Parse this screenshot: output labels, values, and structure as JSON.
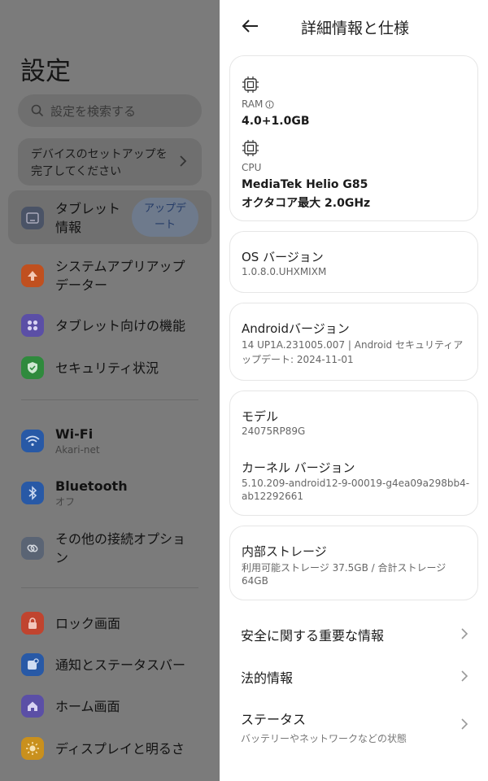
{
  "left": {
    "title": "設定",
    "search_placeholder": "設定を検索する",
    "setup_line1": "デバイスのセットアップを",
    "setup_line2": "完了してください",
    "items": [
      {
        "label1": "タブレット",
        "label2": "情報",
        "color": "#4a5366"
      },
      {
        "label1": "システムアプリアップ",
        "label2": "データー",
        "color": "#c0501f"
      },
      {
        "label1": "タブレット向けの機能",
        "color": "#5b4fa6"
      },
      {
        "label1": "セキュリティ状況",
        "color": "#2f8a3d"
      },
      {
        "label1": "Wi-Fi",
        "sub": "Akari-net",
        "color": "#2859a6"
      },
      {
        "label1": "Bluetooth",
        "sub": "オフ",
        "color": "#2859a6"
      },
      {
        "label1": "その他の接続オプショ",
        "label2": "ン",
        "color": "#5a6474"
      },
      {
        "label1": "ロック画面",
        "color": "#c0442f"
      },
      {
        "label1": "通知とステータスバー",
        "color": "#2859a6"
      },
      {
        "label1": "ホーム画面",
        "color": "#5b4fa6"
      },
      {
        "label1": "ディスプレイと明るさ",
        "color": "#c9901d"
      }
    ],
    "update_line1": "アップデ",
    "update_line2": "ート"
  },
  "right": {
    "title": "詳細情報と仕様",
    "ram_label": "RAM",
    "ram_value": "4.0+1.0GB",
    "cpu_label": "CPU",
    "cpu_value1": "MediaTek Helio G85",
    "cpu_value2": "オクタコア最大 2.0GHz",
    "os_label": "OS バージョン",
    "os_value": "1.0.8.0.UHXMIXM",
    "android_label": "Androidバージョン",
    "android_value1": "14 UP1A.231005.007 | Android セキュリティア",
    "android_value2": "ップデート: 2024-11-01",
    "model_label": "モデル",
    "model_value": "24075RP89G",
    "kernel_label": "カーネル バージョン",
    "kernel_value1": "5.10.209-android12-9-00019-g4ea09a298bb4-",
    "kernel_value2": "ab12292661",
    "storage_label": "内部ストレージ",
    "storage_value1": "利用可能ストレージ  37.5GB / 合計ストレージ",
    "storage_value2": "64GB",
    "links": [
      {
        "title": "安全に関する重要な情報"
      },
      {
        "title": "法的情報"
      },
      {
        "title": "ステータス",
        "sub": "バッテリーやネットワークなどの状態"
      }
    ]
  }
}
